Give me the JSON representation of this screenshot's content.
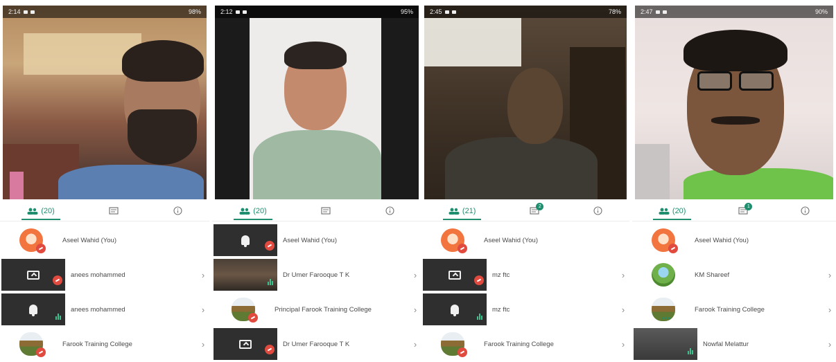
{
  "panels": [
    {
      "status": {
        "time": "2:14",
        "battery": "98%"
      },
      "tabs": {
        "people": "(20)",
        "chat_badge": "",
        "info": "i"
      },
      "rows": [
        {
          "kind": "avatar-orange",
          "name": "Aseel Wahid (You)",
          "mic": "off"
        },
        {
          "kind": "tile-screen",
          "name": "anees mohammed",
          "mic": "off"
        },
        {
          "kind": "tile-bell",
          "name": "anees mohammed",
          "mic": "bars"
        },
        {
          "kind": "avatar-field",
          "name": "Farook Training College",
          "mic": "off"
        }
      ]
    },
    {
      "status": {
        "time": "2:12",
        "battery": "95%"
      },
      "tabs": {
        "people": "(20)",
        "chat_badge": "",
        "info": "i"
      },
      "rows": [
        {
          "kind": "tile-bell",
          "name": "Aseel Wahid (You)",
          "mic": "off"
        },
        {
          "kind": "tile-video",
          "name": "Dr Umer Farooque T K",
          "mic": "bars"
        },
        {
          "kind": "avatar-field",
          "name": "Principal Farook Training College",
          "mic": "off"
        },
        {
          "kind": "tile-screen",
          "name": "Dr Umer Farooque T K",
          "mic": "off"
        }
      ]
    },
    {
      "status": {
        "time": "2:45",
        "battery": "78%"
      },
      "tabs": {
        "people": "(21)",
        "chat_badge": "2",
        "info": "i"
      },
      "rows": [
        {
          "kind": "avatar-orange",
          "name": "Aseel Wahid (You)",
          "mic": "off"
        },
        {
          "kind": "tile-screen",
          "name": "mz ftc",
          "mic": "off"
        },
        {
          "kind": "tile-bell",
          "name": "mz ftc",
          "mic": "bars"
        },
        {
          "kind": "avatar-field",
          "name": "Farook Training College",
          "mic": "off"
        }
      ]
    },
    {
      "status": {
        "time": "2:47",
        "battery": "90%"
      },
      "tabs": {
        "people": "(20)",
        "chat_badge": "1",
        "info": "i"
      },
      "rows": [
        {
          "kind": "avatar-orange",
          "name": "Aseel Wahid (You)",
          "mic": "off"
        },
        {
          "kind": "avatar-green",
          "name": "KM Shareef",
          "mic": "none"
        },
        {
          "kind": "avatar-field",
          "name": "Farook Training College",
          "mic": "dots"
        },
        {
          "kind": "tile-video",
          "name": "Nowfal Melattur",
          "mic": "bars"
        }
      ]
    }
  ],
  "colors": {
    "accent": "#1e8e6e",
    "mic_off": "#e04a3f",
    "audio": "#3fc08f"
  }
}
